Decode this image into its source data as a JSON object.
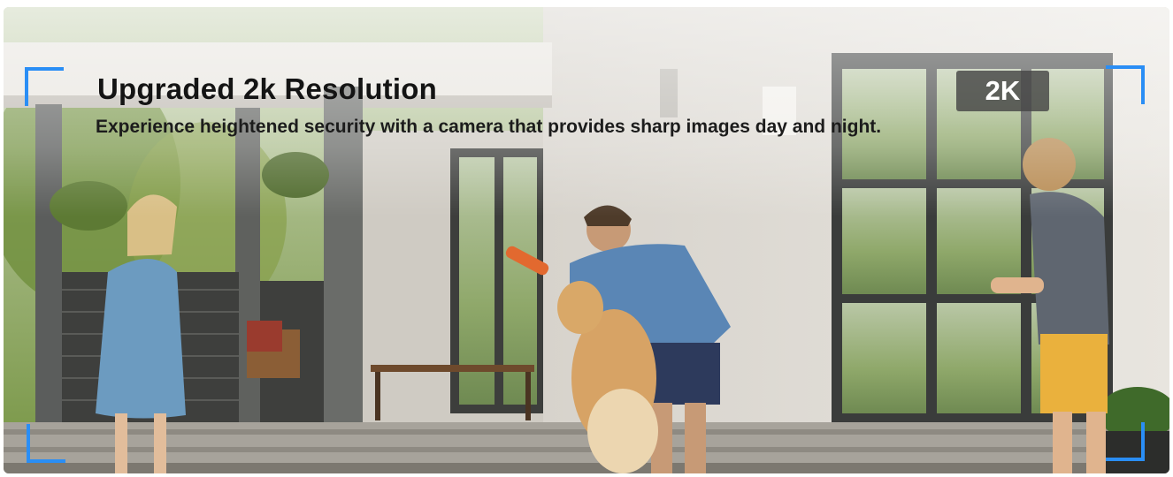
{
  "banner": {
    "title": "Upgraded 2k Resolution",
    "subtitle": "Experience heightened security with a camera that provides sharp images day and night.",
    "badge": "2K",
    "accent_color": "#2a8ef5"
  }
}
